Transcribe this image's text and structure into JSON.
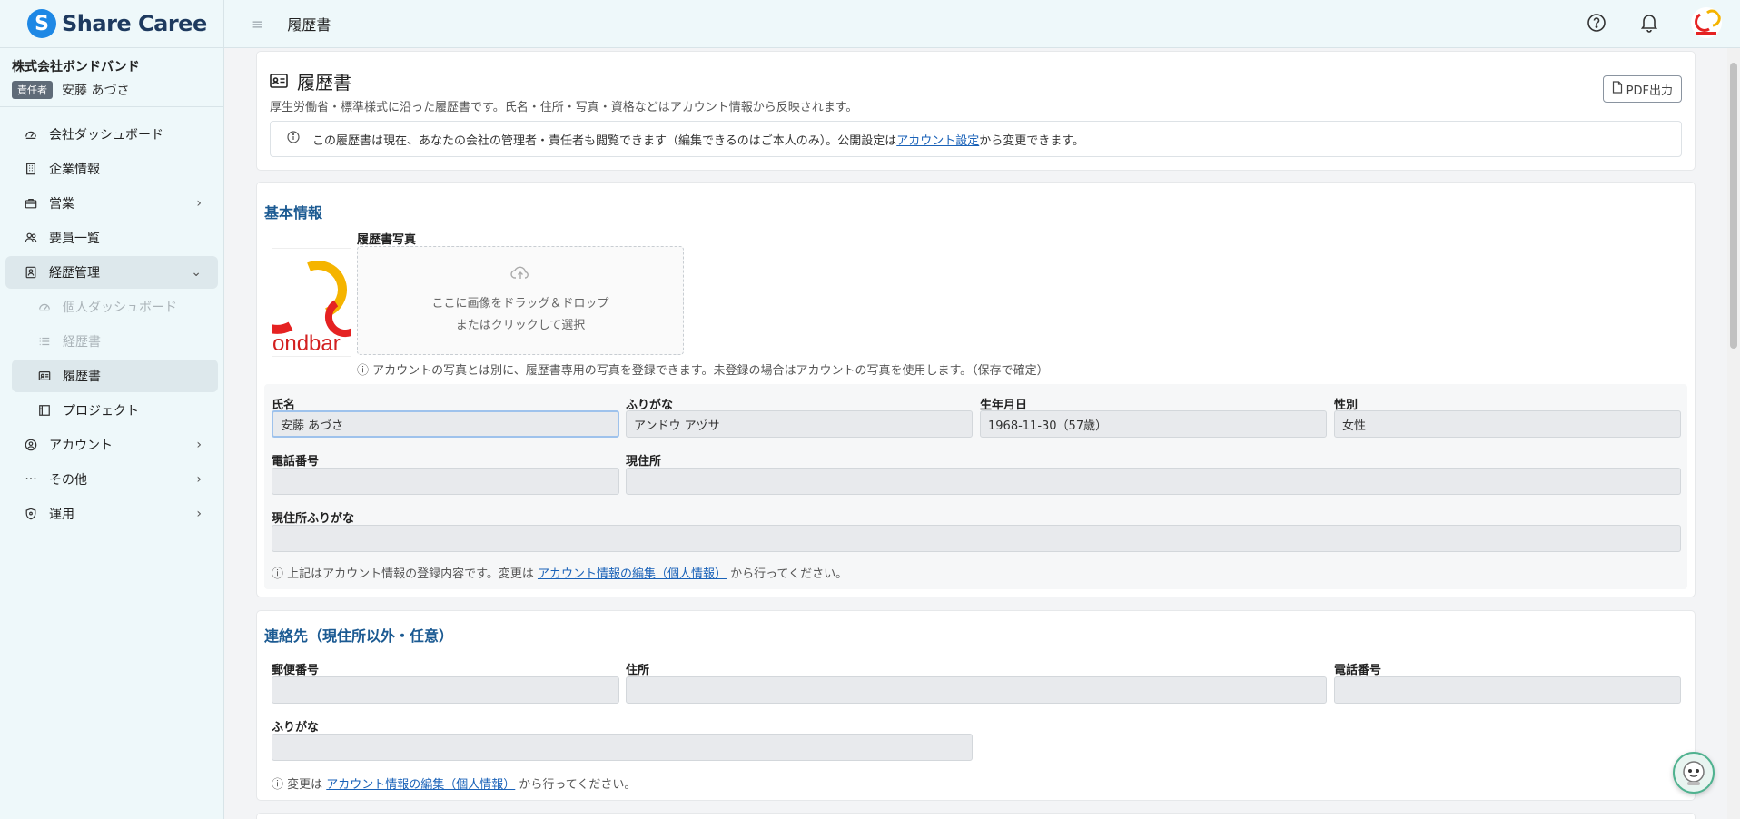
{
  "app": {
    "logo_text": "Share Caree"
  },
  "company": {
    "name": "株式会社ボンドバンド",
    "role": "責任者",
    "user": "安藤 あづさ"
  },
  "sidebar": {
    "items": [
      {
        "label": "会社ダッシュボード",
        "icon": "dashboard-icon"
      },
      {
        "label": "企業情報",
        "icon": "building-icon"
      },
      {
        "label": "営業",
        "icon": "briefcase-icon"
      },
      {
        "label": "要員一覧",
        "icon": "people-icon"
      },
      {
        "label": "経歴管理",
        "icon": "id-card-icon"
      },
      {
        "label": "個人ダッシュボード",
        "icon": "dashboard-icon"
      },
      {
        "label": "経歴書",
        "icon": "list-icon"
      },
      {
        "label": "履歴書",
        "icon": "id-card-icon"
      },
      {
        "label": "プロジェクト",
        "icon": "project-icon"
      },
      {
        "label": "アカウント",
        "icon": "user-circle-icon"
      },
      {
        "label": "その他",
        "icon": "more-icon"
      },
      {
        "label": "運用",
        "icon": "shield-icon"
      }
    ]
  },
  "topbar": {
    "title": "履歴書"
  },
  "header_card": {
    "title": "履歴書",
    "description": "厚生労働省・標準様式に沿った履歴書です。氏名・住所・写真・資格などはアカウント情報から反映されます。",
    "pdf_button": "PDF出力",
    "notice_before": "この履歴書は現在、あなたの会社の管理者・責任者も閲覧できます（編集できるのはご本人のみ）。公開設定は",
    "notice_link": "アカウント設定",
    "notice_after": "から変更できます。"
  },
  "basic": {
    "section_title": "基本情報",
    "photo_label": "履歴書写真",
    "photo_thumb_text": "ondbar",
    "dropzone_line1": "ここに画像をドラッグ＆ドロップ",
    "dropzone_line2": "またはクリックして選択",
    "photo_note": "ⓘ アカウントの写真とは別に、履歴書専用の写真を登録できます。未登録の場合はアカウントの写真を使用します。（保存で確定）",
    "labels": {
      "name": "氏名",
      "furigana": "ふりがな",
      "birthdate": "生年月日",
      "gender": "性別",
      "phone": "電話番号",
      "address": "現住所",
      "address_furigana": "現住所ふりがな"
    },
    "values": {
      "name": "安藤 あづさ",
      "furigana": "アンドウ アヅサ",
      "birthdate": "1968-11-30（57歳）",
      "gender": "女性",
      "phone": "",
      "address": "",
      "address_furigana": ""
    },
    "note_before": "ⓘ 上記はアカウント情報の登録内容です。変更は ",
    "note_link": "アカウント情報の編集（個人情報）",
    "note_after": " から行ってください。"
  },
  "contact": {
    "section_title": "連絡先（現住所以外・任意）",
    "labels": {
      "postal": "郵便番号",
      "address": "住所",
      "phone": "電話番号",
      "furigana": "ふりがな"
    },
    "values": {
      "postal": "",
      "address": "",
      "phone": "",
      "furigana": ""
    },
    "note_before": "ⓘ 変更は ",
    "note_link": "アカウント情報の編集（個人情報）",
    "note_after": " から行ってください。"
  }
}
